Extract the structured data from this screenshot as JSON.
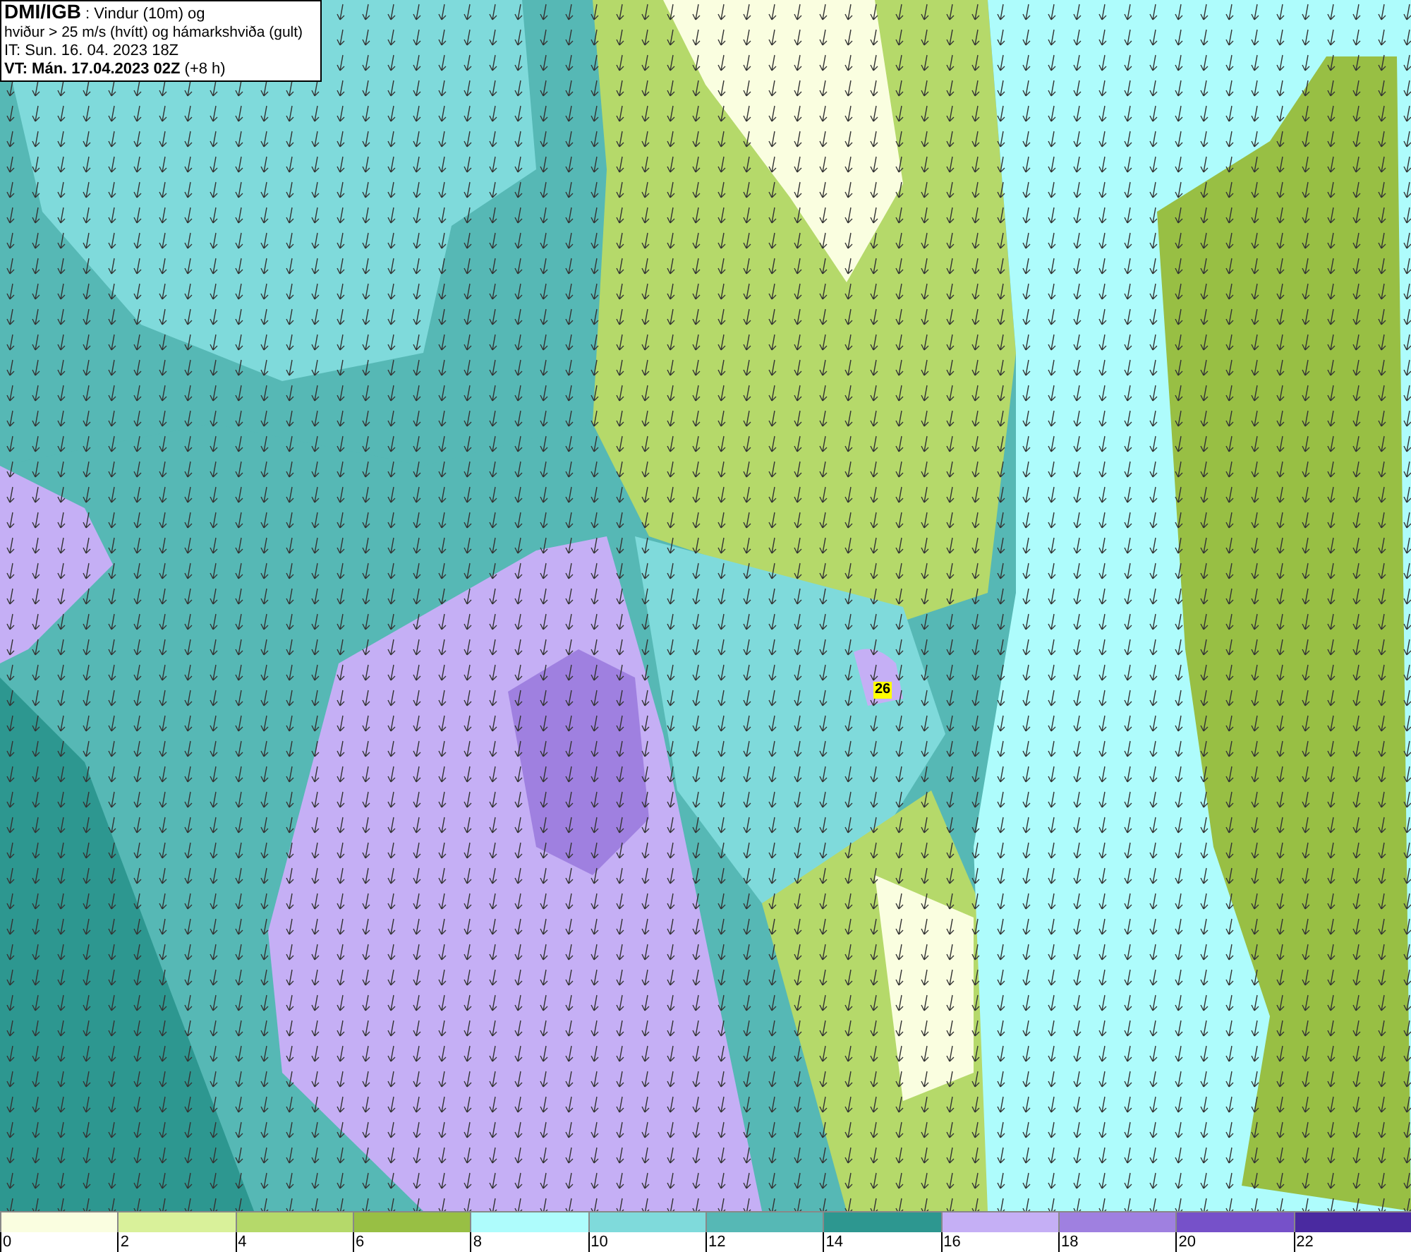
{
  "header": {
    "source": "DMI/IGB",
    "title": ": Vindur (10m) og",
    "subtitle": "hviður > 25 m/s (hvítt) og hámarkshviða (gult)",
    "initial_time": "IT: Sun. 16. 04. 2023 18Z",
    "valid_time": "VT: Mán. 17.04.2023 02Z",
    "lead_time": "(+8 h)"
  },
  "map": {
    "max_gust": "26"
  },
  "legend": [
    {
      "label": "0",
      "color": "#fafee0"
    },
    {
      "label": "2",
      "color": "#d9f19a"
    },
    {
      "label": "4",
      "color": "#b5d96a"
    },
    {
      "label": "6",
      "color": "#98bf44"
    },
    {
      "label": "8",
      "color": "#aefcfc"
    },
    {
      "label": "10",
      "color": "#7fdadb"
    },
    {
      "label": "12",
      "color": "#56b8b5"
    },
    {
      "label": "14",
      "color": "#2d9790"
    },
    {
      "label": "16",
      "color": "#c5aff5"
    },
    {
      "label": "18",
      "color": "#9f80e0"
    },
    {
      "label": "20",
      "color": "#7651c9"
    },
    {
      "label": "22",
      "color": "#4a2aa0"
    }
  ]
}
